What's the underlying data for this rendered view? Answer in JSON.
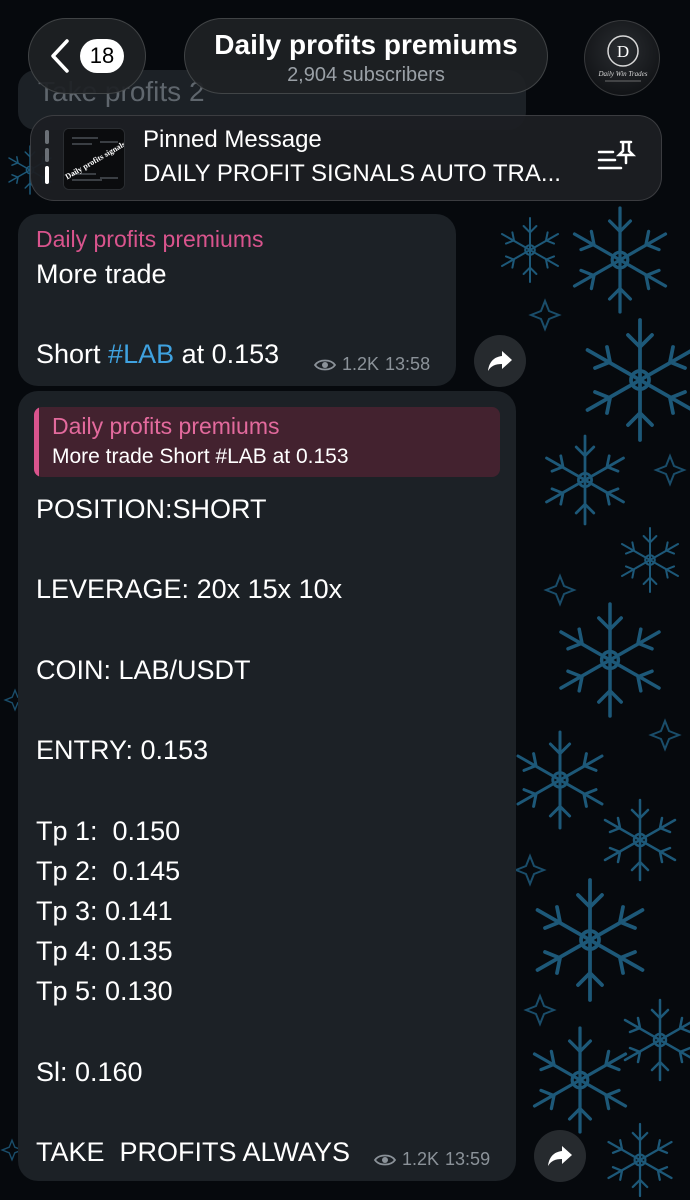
{
  "header": {
    "back_count": "18",
    "title": "Daily profits premiums",
    "subtitle": "2,904 subscribers"
  },
  "previous_message": {
    "text": "Take profits 2"
  },
  "pinned": {
    "title": "Pinned Message",
    "text": "DAILY PROFIT SIGNALS AUTO TRA...",
    "thumbnail_text": "Daily profits signals"
  },
  "messages": [
    {
      "sender": "Daily profits premiums",
      "line1": "More trade",
      "line3_prefix": "Short ",
      "hashtag": "#LAB",
      "line3_suffix": " at 0.153",
      "views": "1.2K",
      "time": "13:58"
    },
    {
      "sender": "Daily profits premiums",
      "reply": {
        "name": "Daily profits premiums",
        "text": "More trade Short #LAB at 0.153"
      },
      "lines": [
        "POSITION:SHORT",
        "",
        "LEVERAGE: 20x 15x 10x",
        "",
        "COIN: LAB/USDT",
        "",
        "ENTRY: 0.153",
        "",
        "Tp 1:  0.150",
        "Tp 2:  0.145",
        "Tp 3: 0.141",
        "Tp 4: 0.135",
        "Tp 5: 0.130",
        "",
        "Sl: 0.160",
        "",
        "TAKE  PROFITS ALWAYS"
      ],
      "views": "1.2K",
      "time": "13:59"
    }
  ],
  "colors": {
    "accent_sender": "#d9548d",
    "hashtag": "#3fa2e0",
    "bubble": "#1c2126",
    "background": "#06090d"
  },
  "icons": [
    "back-chevron-icon",
    "pinned-list-icon",
    "eye-icon",
    "forward-icon"
  ]
}
